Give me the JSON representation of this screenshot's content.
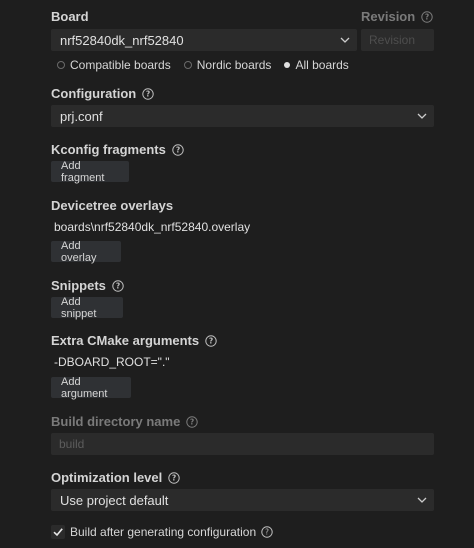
{
  "board": {
    "label": "Board",
    "value": "nrf52840dk_nrf52840",
    "icon": "chevron-down-icon",
    "filters": [
      {
        "label": "Compatible boards",
        "checked": false
      },
      {
        "label": "Nordic boards",
        "checked": false
      },
      {
        "label": "All boards",
        "checked": true
      }
    ]
  },
  "revision": {
    "label": "Revision",
    "placeholder": "Revision",
    "icon": "help-icon"
  },
  "configuration": {
    "label": "Configuration",
    "value": "prj.conf",
    "icon": "help-icon"
  },
  "kconfig": {
    "label": "Kconfig fragments",
    "button": "Add fragment"
  },
  "devicetree": {
    "label": "Devicetree overlays",
    "value": "boards\\nrf52840dk_nrf52840.overlay",
    "button": "Add overlay"
  },
  "snippets": {
    "label": "Snippets",
    "button": "Add snippet"
  },
  "cmake": {
    "label": "Extra CMake arguments",
    "value": "-DBOARD_ROOT=\".\"",
    "button": "Add argument"
  },
  "build_dir": {
    "label": "Build directory name",
    "placeholder": "build"
  },
  "optimization": {
    "label": "Optimization level",
    "value": "Use project default"
  },
  "build_after": {
    "label": "Build after generating configuration",
    "checked": true
  },
  "colors": {
    "background": "#1e1e1e",
    "field": "#2b2b2b",
    "button": "#2f3134",
    "text": "#d4d4d4"
  }
}
